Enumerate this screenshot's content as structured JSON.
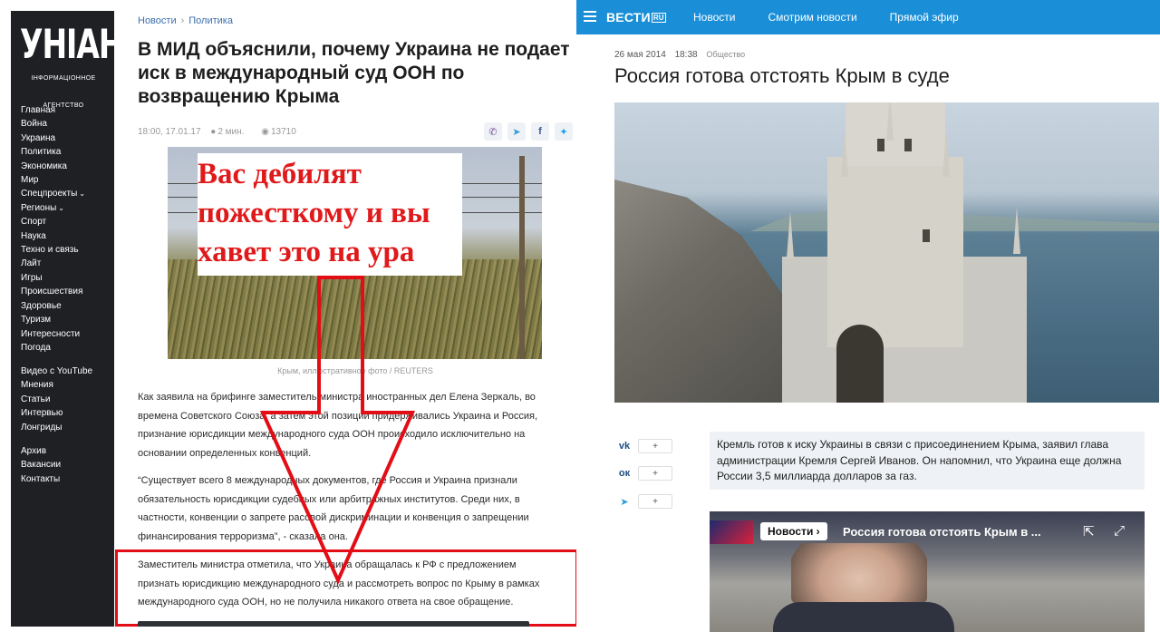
{
  "unian": {
    "logo": "УНІАН",
    "logo_sub_1": "ІНФОРМАЦІОННОЕ",
    "logo_sub_2": "АГЕНТСТВО",
    "nav_main": [
      "Главная",
      "Война",
      "Украина",
      "Политика",
      "Экономика",
      "Мир",
      "Спецпроекты",
      "Регионы",
      "Спорт",
      "Наука",
      "Техно и связь",
      "Лайт",
      "Игры",
      "Происшествия",
      "Здоровье",
      "Туризм",
      "Интересности",
      "Погода"
    ],
    "nav_secondary": [
      "Видео с YouTube",
      "Мнения",
      "Статьи",
      "Интервью",
      "Лонгриды"
    ],
    "nav_tertiary": [
      "Архив",
      "Вакансии",
      "Контакты"
    ],
    "breadcrumb": [
      "Новости",
      "Политика"
    ],
    "title": "В МИД объяснили, почему Украина не подает иск в международный суд ООН по возвращению Крыма",
    "meta_time": "18:00, 17.01.17",
    "meta_read": "2 мин.",
    "meta_views": "13710",
    "share_icons": [
      "viber-icon",
      "telegram-icon",
      "facebook-icon",
      "twitter-icon"
    ],
    "overlay_lines": [
      "Вас дебилят",
      "пожесткому и вы",
      "хавет это на ура"
    ],
    "caption": "Крым, иллюстративное фото / REUTERS",
    "para1": "Как заявила на брифинге заместитель министра иностранных дел Елена Зеркаль, во времена Советского Союза, а затем этой позиции придерживались Украина и Россия, признание юрисдикции международного суда ООН происходило исключительно на основании определенных конвенций.",
    "para2": "“Существует всего 8 международных документов, где Россия и Украина признали обязательность юрисдикции судебных или арбитражных институтов. Среди них, в частности, конвенции о запрете расовой дискриминации и конвенция о запрещении финансирования терроризма”, - сказала она.",
    "para3": "Заместитель министра отметила, что Украина обращалась к РФ с предложением признать юрисдикцию международного суда и рассмотреть вопрос по Крыму в рамках международного суда ООН, но не получила никакого ответа на свое обращение."
  },
  "vesti": {
    "logo": "ВЕСТИ",
    "logo_suffix": "RU",
    "nav": [
      "Новости",
      "Смотрим новости",
      "Прямой эфир"
    ],
    "date": "26 мая 2014",
    "time": "18:38",
    "category": "Общество",
    "title": "Россия готова отстоять Крым в суде",
    "share": [
      {
        "icon": "vk-icon",
        "glyph": "vk",
        "label": "+"
      },
      {
        "icon": "odnoklassniki-icon",
        "glyph": "ok",
        "label": "+"
      },
      {
        "icon": "telegram-icon",
        "glyph": "tg",
        "label": "+"
      }
    ],
    "lead": "Кремль готов к иску Украины в связи с присоединением Крыма, заявил глава администрации Кремля Сергей Иванов. Он напомнил, что Украина еще должна России 3,5 миллиарда долларов за газ.",
    "video_tag": "Новости",
    "video_title": "Россия готова отстоять Крым в ..."
  },
  "colors": {
    "unian_sidebar": "#1e2023",
    "vesti_header": "#1a8fd8",
    "annotation_red": "#e30d16"
  }
}
